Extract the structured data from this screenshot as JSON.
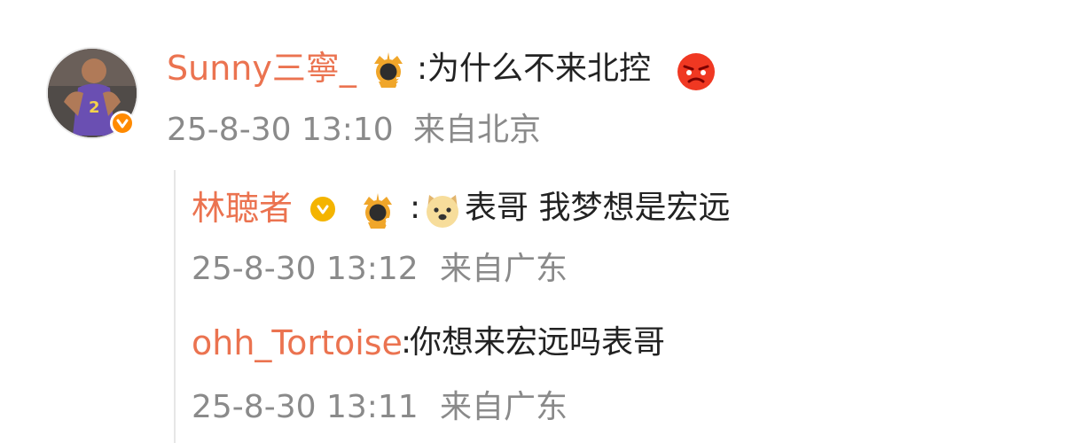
{
  "main_comment": {
    "username": "Sunny三寧_",
    "separator": ":",
    "text": "为什么不来北控",
    "rank_badge": "2",
    "emoji": "angry-face-emoji",
    "timestamp": "25-8-30 13:10",
    "location": "来自北京"
  },
  "replies": [
    {
      "username": "林聴者",
      "separator": ":",
      "text": "表哥 我梦想是宏远",
      "rank_badge": "8",
      "emoji": "doge-emoji",
      "timestamp": "25-8-30 13:12",
      "location": "来自广东"
    },
    {
      "username": "ohh_Tortoise",
      "separator": ":",
      "text": "你想来宏远吗表哥",
      "timestamp": "25-8-30 13:11",
      "location": "来自广东"
    }
  ],
  "colors": {
    "username": "#eb7350",
    "meta": "#8a8a8a",
    "text": "#222222",
    "verified_orange": "#ff8a00",
    "verified_yellow": "#f4b400",
    "badge_gold": "#f0a62a"
  }
}
